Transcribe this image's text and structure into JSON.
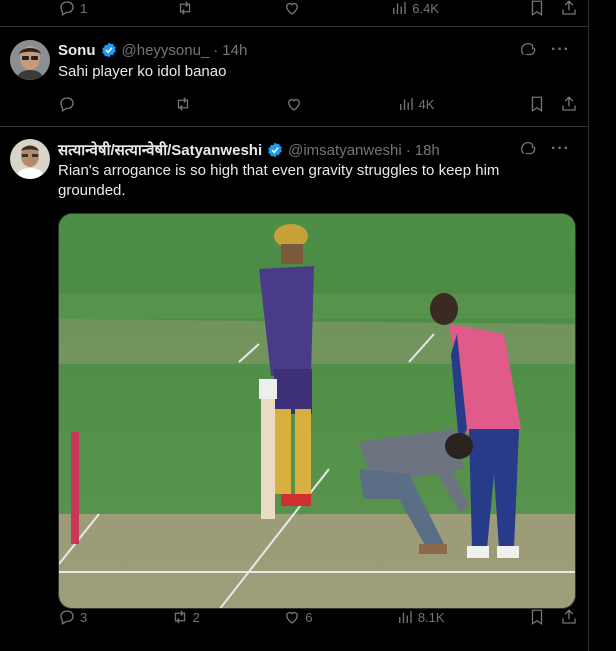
{
  "prev_tweet": {
    "replies": "1",
    "reposts": "",
    "likes": "",
    "views": "6.4K"
  },
  "tweet1": {
    "name": "Sonu",
    "handle": "@heyysonu_",
    "time": "14h",
    "text": "Sahi player ko idol banao",
    "replies": "",
    "reposts": "",
    "likes": "",
    "views": "4K"
  },
  "tweet2": {
    "name": "सत्यान्वेषी/सत्यान्वेषी/Satyanweshi",
    "handle": "@imsatyanweshi",
    "time": "18h",
    "text": "Rian's arrogance is so high that even gravity struggles to keep him grounded.",
    "replies": "3",
    "reposts": "2",
    "likes": "6",
    "views": "8.1K"
  },
  "icons": {
    "reply": "reply-icon",
    "repost": "repost-icon",
    "like": "heart-icon",
    "views": "views-icon",
    "bookmark": "bookmark-icon",
    "share": "share-icon",
    "grok": "grok-icon",
    "more": "more-icon",
    "verified": "verified-badge-icon"
  },
  "colors": {
    "background": "#000000",
    "text": "#e7e9ea",
    "muted": "#71767b",
    "border": "#2f3336",
    "verified": "#1d9bf0"
  },
  "separator": "·",
  "more_glyph": "···"
}
